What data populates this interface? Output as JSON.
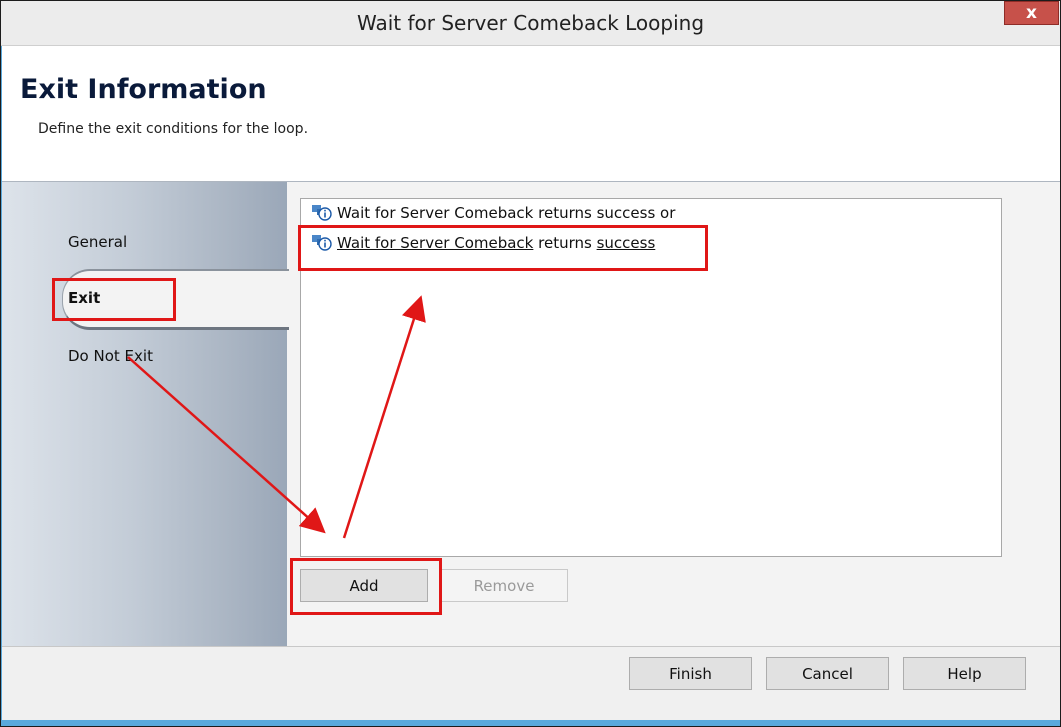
{
  "window": {
    "title": "Wait for Server Comeback Looping",
    "close_label": "x"
  },
  "header": {
    "title": "Exit Information",
    "subtitle": "Define the exit conditions for the loop."
  },
  "nav": {
    "items": [
      {
        "label": "General"
      },
      {
        "label": "Exit",
        "selected": true
      },
      {
        "label": "Do Not Exit"
      }
    ]
  },
  "conditions": [
    {
      "part1": "Wait for Server Comeback returns success or",
      "part2": "",
      "part3": "",
      "part4": ""
    },
    {
      "part1": "Wait for Server Comeback",
      "part2": " returns ",
      "part3": "success",
      "part4": ""
    }
  ],
  "list_buttons": {
    "add": "Add",
    "remove": "Remove"
  },
  "footer_buttons": {
    "finish": "Finish",
    "cancel": "Cancel",
    "help": "Help"
  },
  "annotation_color": "#e01717"
}
